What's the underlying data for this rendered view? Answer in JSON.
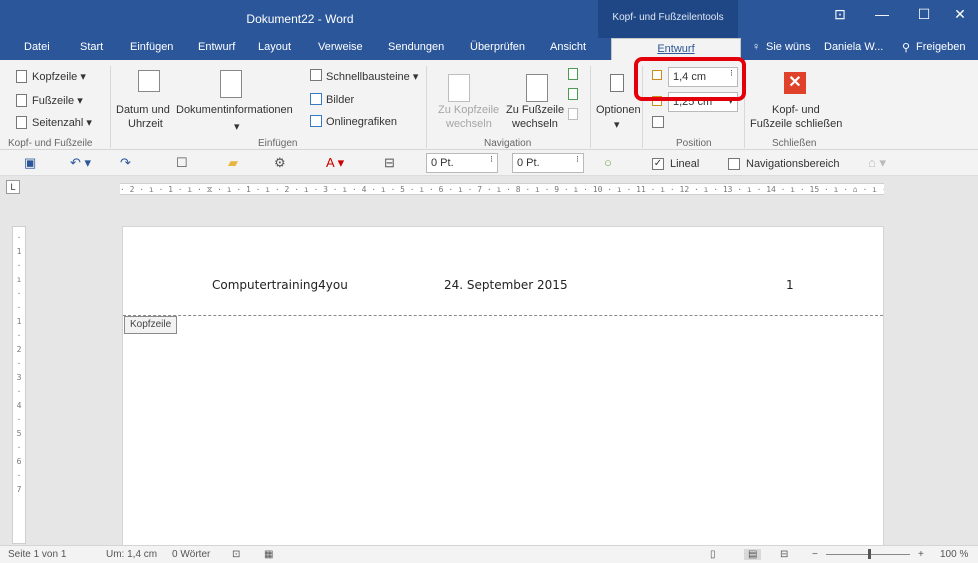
{
  "window": {
    "title": "Dokument22 - Word",
    "context_title": "Kopf- und Fußzeilentools",
    "btn_ribbon_display": "⊡",
    "btn_minimize": "—",
    "btn_maximize": "☐",
    "btn_close": "✕"
  },
  "tabs": [
    "Datei",
    "Start",
    "Einfügen",
    "Entwurf",
    "Layout",
    "Verweise",
    "Sendungen",
    "Überprüfen",
    "Ansicht"
  ],
  "tab_active": "Entwurf",
  "tell_me": "Sie wüns",
  "user": "Daniela W...",
  "share": "Freigeben",
  "ribbon": {
    "kopfzeile": "Kopfzeile",
    "fusszeile": "Fußzeile",
    "seitenzahl": "Seitenzahl",
    "group_hf": "Kopf- und Fußzeile",
    "datum_l1": "Datum und",
    "datum_l2": "Uhrzeit",
    "dokinfo": "Dokumentinformationen",
    "schnellbausteine": "Schnellbausteine",
    "bilder": "Bilder",
    "onlinegrafiken": "Onlinegrafiken",
    "group_einfuegen": "Einfügen",
    "zu_kopf_l1": "Zu Kopfzeile",
    "zu_kopf_l2": "wechseln",
    "zu_fuss_l1": "Zu Fußzeile",
    "zu_fuss_l2": "wechseln",
    "group_navigation": "Navigation",
    "optionen": "Optionen",
    "header_pos": "1,4 cm",
    "footer_pos": "1,25 cm",
    "group_position": "Position",
    "close_l1": "Kopf- und",
    "close_l2": "Fußzeile schließen",
    "group_schliessen": "Schließen"
  },
  "qat": {
    "spin1": "0 Pt.",
    "spin2": "0 Pt.",
    "lineal": "Lineal",
    "navbereich": "Navigationsbereich"
  },
  "ruler": {
    "h_ticks": "· 2 · ı · 1 · ı · ⧖ · ı · 1 · ı · 2 · ı · 3 · ı · 4 · ı · 5 · ı · 6 · ı · 7 · ı · 8 · ı · 9 · ı · 10 · ı · 11 · ı · 12 · ı · 13 · ı · 14 · ı · 15 · ı · ⌂ · ı · 17 · ı · 18 · ı",
    "tab_stop": "L",
    "v_ticks": [
      "·",
      "1",
      "·",
      "ı",
      "·",
      "·",
      "1",
      "·",
      "2",
      "·",
      "3",
      "·",
      "4",
      "·",
      "5",
      "·",
      "6",
      "·",
      "7"
    ]
  },
  "document": {
    "header_left": "Computertraining4you",
    "header_center": "24. September 2015",
    "header_right": "1",
    "header_tag": "Kopfzeile"
  },
  "status": {
    "page": "Seite 1 von 1",
    "pos": "Um: 1,4 cm",
    "words": "0 Wörter",
    "zoom": "100 %"
  },
  "colors": {
    "accent": "#2b579a",
    "highlight": "#e3000b",
    "close_button": "#e0412b"
  }
}
